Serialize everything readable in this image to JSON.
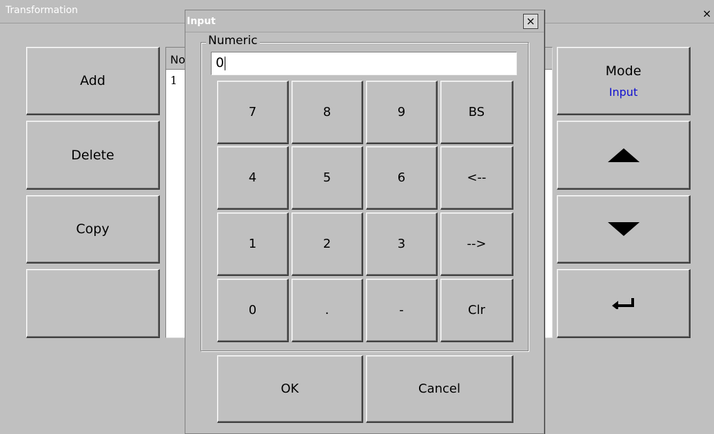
{
  "main_window": {
    "title": "Transformation",
    "close_glyph": "×"
  },
  "left_buttons": [
    {
      "label": "Add"
    },
    {
      "label": "Delete"
    },
    {
      "label": "Copy"
    },
    {
      "label": ""
    }
  ],
  "table": {
    "header_no": "No",
    "rows": [
      {
        "no": "1"
      }
    ]
  },
  "right_panel": {
    "mode_label": "Mode",
    "mode_value": "Input",
    "mode_value_color": "#1010d0",
    "up_icon": "up-arrow-icon",
    "down_icon": "down-arrow-icon",
    "enter_icon": "enter-icon"
  },
  "dialog": {
    "title": "Input",
    "close_glyph": "×",
    "group_label": "Numeric",
    "input_value": "0",
    "keypad": [
      [
        "7",
        "8",
        "9",
        "BS"
      ],
      [
        "4",
        "5",
        "6",
        "<--"
      ],
      [
        "1",
        "2",
        "3",
        "-->"
      ],
      [
        "0",
        ".",
        "-",
        "Clr"
      ]
    ],
    "ok_label": "OK",
    "cancel_label": "Cancel"
  }
}
